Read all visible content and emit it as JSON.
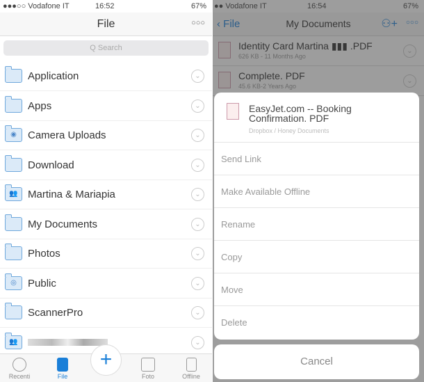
{
  "left": {
    "status": {
      "carrier": "●●●○○ Vodafone IT",
      "time": "16:52",
      "battery": "67%"
    },
    "nav": {
      "title": "File",
      "more": "○○○"
    },
    "search": {
      "placeholder": "Q Search"
    },
    "folders": [
      {
        "name": "Application",
        "icon": "folder-icon"
      },
      {
        "name": "Apps",
        "icon": "folder-icon"
      },
      {
        "name": "Camera Uploads",
        "icon": "camera-folder-icon"
      },
      {
        "name": "Download",
        "icon": "folder-icon"
      },
      {
        "name": "Martina & Mariapia",
        "icon": "shared-folder-icon"
      },
      {
        "name": "My Documents",
        "icon": "folder-icon"
      },
      {
        "name": "Photos",
        "icon": "folder-icon"
      },
      {
        "name": "Public",
        "icon": "public-folder-icon"
      },
      {
        "name": "ScannerPro",
        "icon": "folder-icon"
      },
      {
        "name": "",
        "icon": "shared-folder-icon"
      }
    ],
    "tabs": [
      {
        "label": "Recenti"
      },
      {
        "label": "File",
        "active": true
      },
      {
        "label": "Foto"
      },
      {
        "label": "Offline"
      }
    ],
    "plus": "+"
  },
  "right": {
    "status": {
      "carrier": "●● Vodafone IT",
      "time": "16:54",
      "battery": "67%"
    },
    "nav": {
      "back": "File",
      "title": "My Documents",
      "more": "○○○"
    },
    "files": [
      {
        "name": "Identity Card Martina ▮▮▮ .PDF",
        "meta": "626 KB - 11 Months Ago"
      },
      {
        "name": "Complete. PDF",
        "meta": "45.6 KB-2 Years Ago"
      }
    ],
    "sheet": {
      "title": "EasyJet.com -- Booking Confirmation. PDF",
      "path": "Dropbox / Honey Documents",
      "actions": [
        "Send Link",
        "Make Available Offline",
        "Rename",
        "Copy",
        "Move",
        "Delete"
      ],
      "cancel": "Cancel"
    }
  },
  "colors": {
    "accent": "#1a7fd8"
  }
}
